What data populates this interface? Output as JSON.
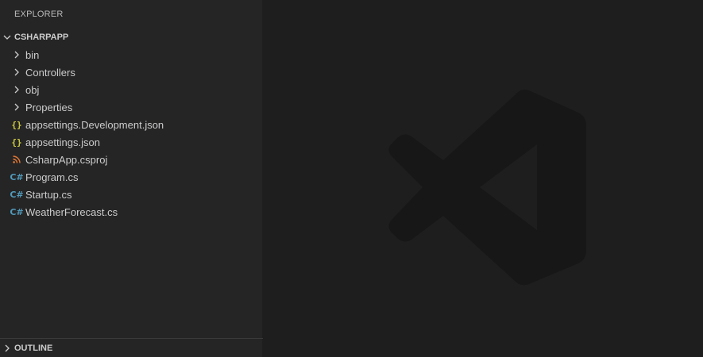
{
  "sidebar": {
    "title": "EXPLORER",
    "folder": "CSHARPAPP",
    "items": [
      {
        "label": "bin",
        "kind": "folder",
        "icon": "chevron-right-icon"
      },
      {
        "label": "Controllers",
        "kind": "folder",
        "icon": "chevron-right-icon"
      },
      {
        "label": "obj",
        "kind": "folder",
        "icon": "chevron-right-icon"
      },
      {
        "label": "Properties",
        "kind": "folder",
        "icon": "chevron-right-icon"
      },
      {
        "label": "appsettings.Development.json",
        "kind": "file",
        "icon": "json-icon"
      },
      {
        "label": "appsettings.json",
        "kind": "file",
        "icon": "json-icon"
      },
      {
        "label": "CsharpApp.csproj",
        "kind": "file",
        "icon": "rss-icon"
      },
      {
        "label": "Program.cs",
        "kind": "file",
        "icon": "csharp-icon"
      },
      {
        "label": "Startup.cs",
        "kind": "file",
        "icon": "csharp-icon"
      },
      {
        "label": "WeatherForecast.cs",
        "kind": "file",
        "icon": "csharp-icon"
      }
    ],
    "outline": "OUTLINE"
  },
  "icons": {
    "json_glyph": "{}",
    "csharp_glyph": "C#"
  },
  "colors": {
    "sidebar_bg": "#252526",
    "editor_bg": "#1e1e1e",
    "json": "#cbcb41",
    "csproj": "#e37933",
    "csharp": "#519aba",
    "watermark": "#171717"
  }
}
